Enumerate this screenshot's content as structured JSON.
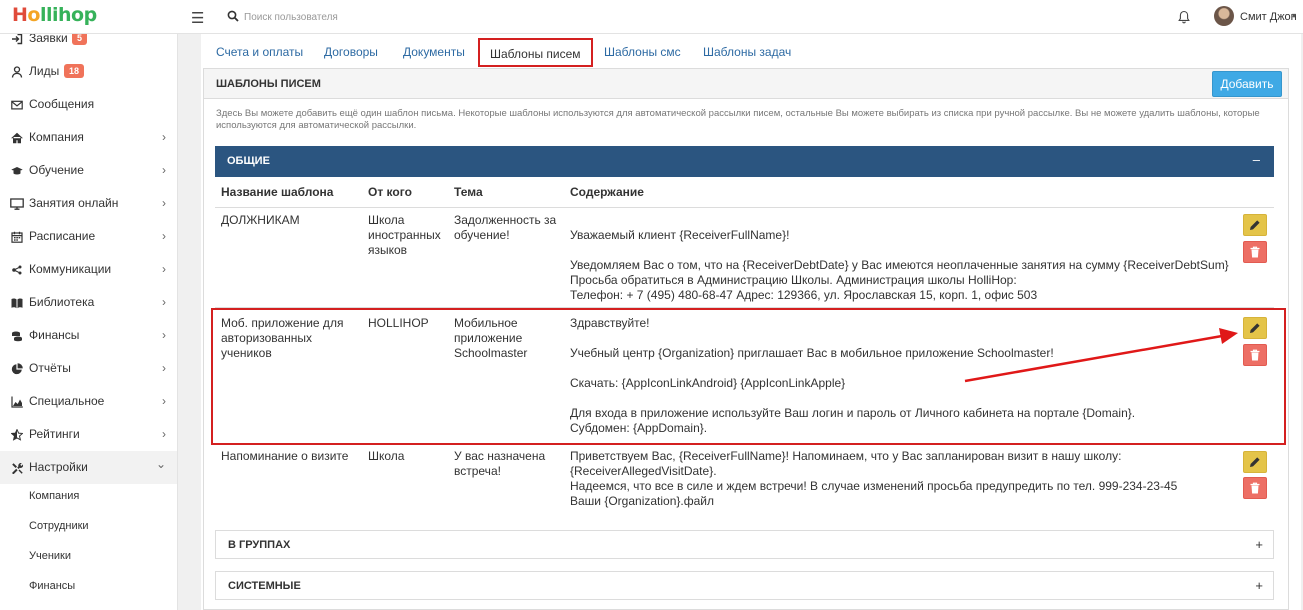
{
  "header": {
    "logo_h": "H",
    "logo_o": "o",
    "logo_rest": "llihop",
    "search_placeholder": "Поиск пользователя",
    "user_name": "Смит Джон",
    "user_caret": "▾",
    "menu_glyph": "☰"
  },
  "sidebar": {
    "items": [
      {
        "label": "Заявки",
        "badge": "5",
        "icon": "sign-in-icon",
        "chevron": ""
      },
      {
        "label": "Лиды",
        "badge": "18",
        "icon": "user-icon",
        "chevron": ""
      },
      {
        "label": "Сообщения",
        "badge": "",
        "icon": "envelope-icon",
        "chevron": ""
      },
      {
        "label": "Компания",
        "badge": "",
        "icon": "home-icon",
        "chevron": "›"
      },
      {
        "label": "Обучение",
        "badge": "",
        "icon": "graduation-cap-icon",
        "chevron": "›"
      },
      {
        "label": "Занятия онлайн",
        "badge": "",
        "icon": "monitor-icon",
        "chevron": "›"
      },
      {
        "label": "Расписание",
        "badge": "",
        "icon": "calendar-icon",
        "chevron": "›"
      },
      {
        "label": "Коммуникации",
        "badge": "",
        "icon": "communications-icon",
        "chevron": "›"
      },
      {
        "label": "Библиотека",
        "badge": "",
        "icon": "book-icon",
        "chevron": "›"
      },
      {
        "label": "Финансы",
        "badge": "",
        "icon": "coins-icon",
        "chevron": "›"
      },
      {
        "label": "Отчёты",
        "badge": "",
        "icon": "pie-chart-icon",
        "chevron": "›"
      },
      {
        "label": "Специальное",
        "badge": "",
        "icon": "area-chart-icon",
        "chevron": "›"
      },
      {
        "label": "Рейтинги",
        "badge": "",
        "icon": "star-half-icon",
        "chevron": "›"
      },
      {
        "label": "Настройки",
        "badge": "",
        "icon": "tools-icon",
        "chevron": "⌄"
      }
    ],
    "sub_items": [
      "Компания",
      "Сотрудники",
      "Ученики",
      "Финансы"
    ]
  },
  "tabs": [
    "Счета и оплаты",
    "Договоры",
    "Документы",
    "Шаблоны писем",
    "Шаблоны смс",
    "Шаблоны задач"
  ],
  "panel": {
    "title": "ШАБЛОНЫ ПИСЕМ",
    "add_label": "Добавить",
    "description": "Здесь Вы можете добавить ещё один шаблон письма. Некоторые шаблоны используются для автоматической рассылки писем, остальные Вы можете выбирать из списка при ручной рассылке. Вы не можете удалить шаблоны, которые используются для автоматической рассылки."
  },
  "group_general": {
    "title": "ОБЩИЕ",
    "collapse": "–"
  },
  "columns": [
    "Название шаблона",
    "От кого",
    "Тема",
    "Содержание"
  ],
  "rows": [
    {
      "name": "ДОЛЖНИКАМ",
      "from": "Школа иностранных языков",
      "subject": "Задолженность за обучение!",
      "content": "Уважаемый клиент {ReceiverFullName}!\n\nУведомляем Вас о том, что на {ReceiverDebtDate} у Вас имеются неоплаченные занятия на сумму {ReceiverDebtSum}\nПросьба обратиться в Администрацию Школы.    Администрация школы HolliHop:\nТелефон: + 7 (495) 480-68-47 Адрес: 129366, ул. Ярославская 15, корп. 1, офис 503"
    },
    {
      "name": "Моб. приложение для авторизованных учеников",
      "from": "HOLLIHOP",
      "subject": "Мобильное приложение Schoolmaster",
      "content": "Здравствуйте!\n\nУчебный центр {Organization} приглашает Вас в мобильное приложение Schoolmaster!\n\nСкачать: {AppIconLinkAndroid}  {AppIconLinkApple}\n\nДля входа в приложение используйте Ваш логин и пароль от Личного кабинета на портале {Domain}.\nСубдомен: {AppDomain}."
    },
    {
      "name": "Напоминание о визите",
      "from": "Школа",
      "subject": "У вас назначена встреча!",
      "content": "Приветствуем Вас, {ReceiverFullName}! Напоминаем, что у Вас запланирован визит в нашу школу: {ReceiverAllegedVisitDate}.\nНадеемся, что все в силе и ждем встречи! В случае изменений просьба предупредить по тел. 999-234-23-45\n Ваши {Organization}.файл"
    }
  ],
  "other_groups": [
    {
      "title": "В ГРУППАХ",
      "expand": "+"
    },
    {
      "title": "СИСТЕМНЫЕ",
      "expand": "+"
    }
  ],
  "colors": {
    "accent": "#3fa9e5",
    "group_header": "#2b5580",
    "highlight": "#d42020",
    "edit": "#e4c449",
    "delete": "#ed6f65",
    "badge": "#f0735a"
  }
}
